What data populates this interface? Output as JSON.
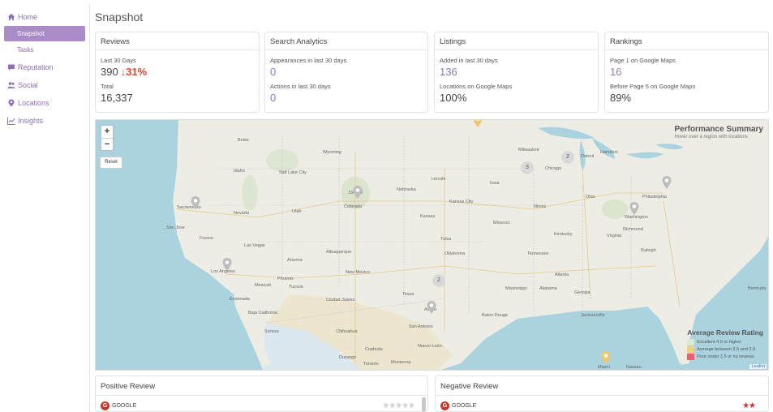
{
  "sidebar": {
    "home": "Home",
    "snapshot": "Snapshot",
    "tasks": "Tasks",
    "reputation": "Reputation",
    "social": "Social",
    "locations": "Locations",
    "insights": "Insights"
  },
  "page": {
    "title": "Snapshot"
  },
  "cards": {
    "reviews": {
      "title": "Reviews",
      "label1": "Last 30 Days",
      "value1": "390",
      "delta": "↓31%",
      "label2": "Total",
      "value2": "16,337"
    },
    "search": {
      "title": "Search Analytics",
      "label1": "Appearances in last 30 days",
      "value1": "0",
      "label2": "Actions in last 30 days",
      "value2": "0"
    },
    "listings": {
      "title": "Listings",
      "label1": "Added in last 30 days",
      "value1": "136",
      "label2": "Locations on Google Maps",
      "value2": "100%"
    },
    "rankings": {
      "title": "Rankings",
      "label1": "Page 1 on Google Maps",
      "value1": "16",
      "label2": "Before Page 5 on Google Maps",
      "value2": "89%"
    }
  },
  "map": {
    "zoom_in": "+",
    "zoom_out": "−",
    "reset": "Reset",
    "summary_title": "Performance Summary",
    "summary_sub": "Hover over a region with locations",
    "legend_title": "Average Review Rating",
    "legend": [
      {
        "label": "Excellent 4.0 or higher",
        "color": "#d8ecd4"
      },
      {
        "label": "Average between 2.5 and 3.9",
        "color": "#f1cf83"
      },
      {
        "label": "Poor under 2.5 or no reviews",
        "color": "#e8636b"
      }
    ],
    "attribution": "Leaflet",
    "clusters": [
      "2",
      "3",
      "2"
    ],
    "cities": [
      "Boise",
      "Salt Lake City",
      "Denver",
      "Colorado",
      "Sacramento",
      "San Jose",
      "Fresno",
      "Las Vegas",
      "Los Angeles",
      "Mexicali",
      "Phoenix",
      "Tucson",
      "Ensenada",
      "Baja California",
      "Albuquerque",
      "Ciudad Juárez",
      "Chihuahua",
      "Torreón",
      "Monterrey",
      "Nuevo León",
      "Coahuila",
      "Austin",
      "San Antonio",
      "Tulsa",
      "Kansas City",
      "Lincoln",
      "Milwaukee",
      "Chicago",
      "Detroit",
      "Hamilton",
      "Philadelphia",
      "Washington",
      "Richmond",
      "Atlanta",
      "Raleigh",
      "Jacksonville",
      "Baton Rouge",
      "Miami",
      "Nassau",
      "Nebraska",
      "Wyoming",
      "Idaho",
      "Nevada",
      "Utah",
      "Arizona",
      "New Mexico",
      "Oklahoma",
      "Kansas",
      "Missouri",
      "Iowa",
      "Illinois",
      "Ohio",
      "Virginia",
      "Kentucky",
      "Tennessee",
      "Georgia",
      "Alabama",
      "Mississippi",
      "Texas",
      "Sonora",
      "Durango",
      "Bermuda"
    ]
  },
  "positive": {
    "title": "Positive Review",
    "source": "GOOGLE",
    "stars": "★★★★★"
  },
  "negative": {
    "title": "Negative Review",
    "source": "GOOGLE",
    "stars": "★★"
  },
  "colors": {
    "accent": "#8c6fb4",
    "active": "#a98bc8",
    "delta": "#e0452b",
    "star_gray": "#d0d0d0",
    "star_red": "#d62e2e"
  }
}
